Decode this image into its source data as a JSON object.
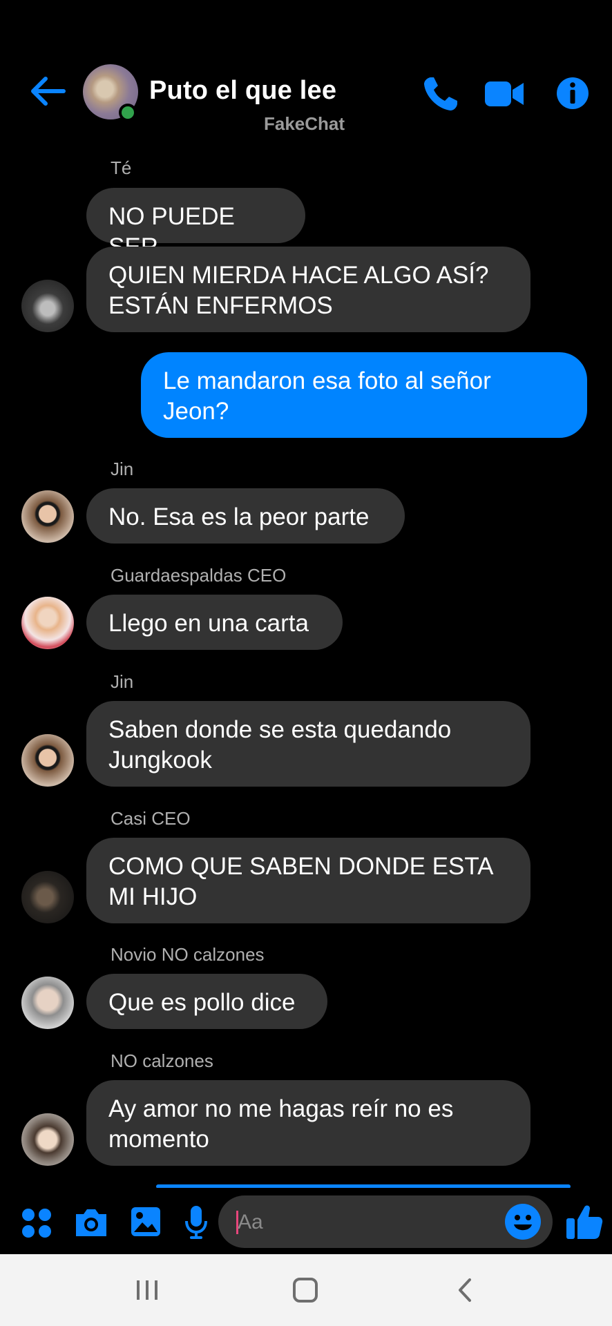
{
  "header": {
    "title": "Puto el que lee",
    "subtitle": "FakeChat"
  },
  "messages": [
    {
      "sender": "Té",
      "lines": [
        "NO PUEDE SER"
      ],
      "direction": "in"
    },
    {
      "sender": "",
      "lines": [
        "QUIEN MIERDA HACE ALGO ASÍ?",
        "ESTÁN ENFERMOS"
      ],
      "direction": "in"
    },
    {
      "sender": "",
      "lines": [
        "Le mandaron esa foto al señor",
        "Jeon?"
      ],
      "direction": "out"
    },
    {
      "sender": "Jin",
      "lines": [
        "No. Esa es la peor parte"
      ],
      "direction": "in"
    },
    {
      "sender": "Guardaespaldas CEO",
      "lines": [
        "Llego en una carta"
      ],
      "direction": "in"
    },
    {
      "sender": "Jin",
      "lines": [
        "Saben donde se esta quedando",
        "Jungkook"
      ],
      "direction": "in"
    },
    {
      "sender": "Casi CEO",
      "lines": [
        "COMO QUE SABEN DONDE ESTA",
        "MI HIJO"
      ],
      "direction": "in"
    },
    {
      "sender": "Novio NO calzones",
      "lines": [
        "Que es pollo dice"
      ],
      "direction": "in"
    },
    {
      "sender": "NO calzones",
      "lines": [
        "Ay amor no me hagas reír no es",
        "momento"
      ],
      "direction": "in"
    }
  ],
  "composer": {
    "placeholder": "Aa"
  },
  "icons": {
    "back": "arrow-left-icon",
    "phone": "phone-icon",
    "video": "video-camera-icon",
    "info": "info-icon",
    "apps": "apps-grid-icon",
    "camera": "camera-icon",
    "gallery": "image-icon",
    "mic": "microphone-icon",
    "emoji": "emoji-icon",
    "like": "thumbs-up-icon"
  },
  "colors": {
    "accent": "#0084ff",
    "incoming_bubble": "#333333",
    "background": "#000000",
    "online": "#31a24c"
  }
}
